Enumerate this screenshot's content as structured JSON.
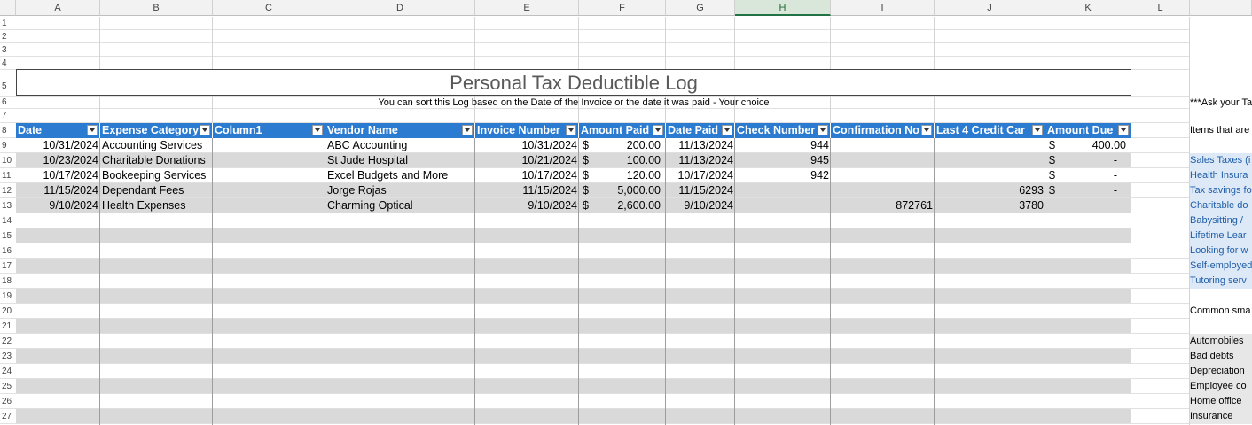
{
  "column_letters": [
    "A",
    "B",
    "C",
    "D",
    "E",
    "F",
    "G",
    "H",
    "I",
    "J",
    "K",
    "L"
  ],
  "selected_column": "H",
  "row_numbers": [
    1,
    2,
    3,
    4,
    5,
    6,
    7,
    8,
    9,
    10,
    11,
    12,
    13,
    14,
    15,
    16,
    17,
    18,
    19,
    20,
    21,
    22,
    23,
    24,
    25,
    26,
    27
  ],
  "title": "Personal Tax Deductible Log",
  "subtitle": "You can sort this Log based on the Date of the Invoice or the date it was paid - Your choice",
  "table": {
    "headers": [
      "Date",
      "Expense Category",
      "Column1",
      "Vendor Name",
      "Invoice Number",
      "Amount Paid",
      "Date Paid",
      "Check Number",
      "Confirmation No",
      "Last 4 Credit Car",
      "Amount Due"
    ],
    "rows": [
      {
        "date": "10/31/2024",
        "category": "Accounting Services",
        "column1": "",
        "vendor": "ABC Accounting",
        "invoice": "10/31/2024",
        "amount_currency": "$",
        "amount_paid": "200.00",
        "date_paid": "11/13/2024",
        "check": "944",
        "confirmation": "",
        "card": "",
        "due_currency": "$",
        "amount_due": "400.00"
      },
      {
        "date": "10/23/2024",
        "category": "Charitable Donations",
        "column1": "",
        "vendor": "St Jude Hospital",
        "invoice": "10/21/2024",
        "amount_currency": "$",
        "amount_paid": "100.00",
        "date_paid": "11/13/2024",
        "check": "945",
        "confirmation": "",
        "card": "",
        "due_currency": "$",
        "amount_due": "-"
      },
      {
        "date": "10/17/2024",
        "category": "Bookeeping Services",
        "column1": "",
        "vendor": "Excel Budgets and More",
        "invoice": "10/17/2024",
        "amount_currency": "$",
        "amount_paid": "120.00",
        "date_paid": "10/17/2024",
        "check": "942",
        "confirmation": "",
        "card": "",
        "due_currency": "$",
        "amount_due": "-"
      },
      {
        "date": "11/15/2024",
        "category": "Dependant Fees",
        "column1": "",
        "vendor": "Jorge Rojas",
        "invoice": "11/15/2024",
        "amount_currency": "$",
        "amount_paid": "5,000.00",
        "date_paid": "11/15/2024",
        "check": "",
        "confirmation": "",
        "card": "6293",
        "due_currency": "$",
        "amount_due": "-"
      },
      {
        "date": "9/10/2024",
        "category": "Health Expenses",
        "column1": "",
        "vendor": "Charming Optical",
        "invoice": "9/10/2024",
        "amount_currency": "$",
        "amount_paid": "2,600.00",
        "date_paid": "9/10/2024",
        "check": "",
        "confirmation": "872761",
        "card": "3780",
        "due_currency": "",
        "amount_due": ""
      }
    ]
  },
  "side_notes": {
    "ask": "***Ask your Ta",
    "items_heading": "Items that are",
    "blue_items": [
      "Sales Taxes (i",
      "Health Insura",
      "Tax savings fo",
      "Charitable do",
      "Babysitting /",
      "Lifetime Lear",
      "Looking for w",
      "Self-employed",
      "Tutoring serv"
    ],
    "common_heading": "Common sma",
    "gray_items": [
      "Automobiles",
      "Bad debts",
      "Depreciation",
      "Employee co",
      "Home office",
      "Insurance"
    ]
  },
  "colors": {
    "header_blue": "#2b7bd1",
    "band_gray": "#d9d9d9",
    "side_blue": "#dde9f7",
    "selected_col": "#217346"
  }
}
